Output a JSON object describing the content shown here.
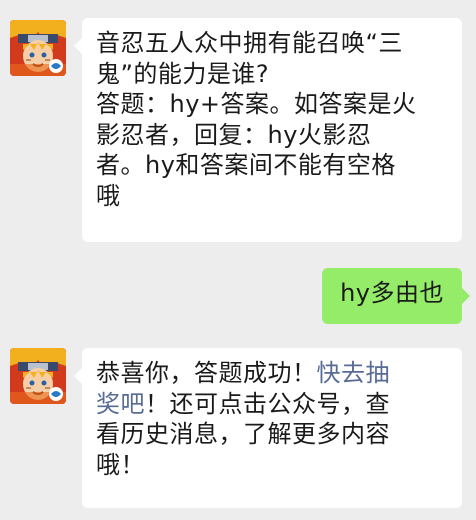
{
  "messages": [
    {
      "sender": "bot",
      "avatar_icon": "naruto-avatar-icon",
      "lines": [
        "音忍五人众中拥有能召唤“三",
        "鬼”的能力是谁?",
        "答题：hy+答案。如答案是火",
        "影忍者，回复：hy火影忍",
        "者。hy和答案间不能有空格",
        "哦"
      ]
    },
    {
      "sender": "user",
      "text": "hy多由也"
    },
    {
      "sender": "bot",
      "avatar_icon": "naruto-avatar-icon",
      "line1_prefix": "恭喜你，答题成功！",
      "link_part1": "快去抽",
      "link_part2": "奖吧",
      "line2_suffix": "！还可点击公众号，查",
      "line3": "看历史消息，了解更多内容",
      "line4": "哦！"
    }
  ],
  "colors": {
    "background": "#ededed",
    "bot_bubble": "#ffffff",
    "user_bubble": "#95ec69",
    "link": "#576b95"
  }
}
